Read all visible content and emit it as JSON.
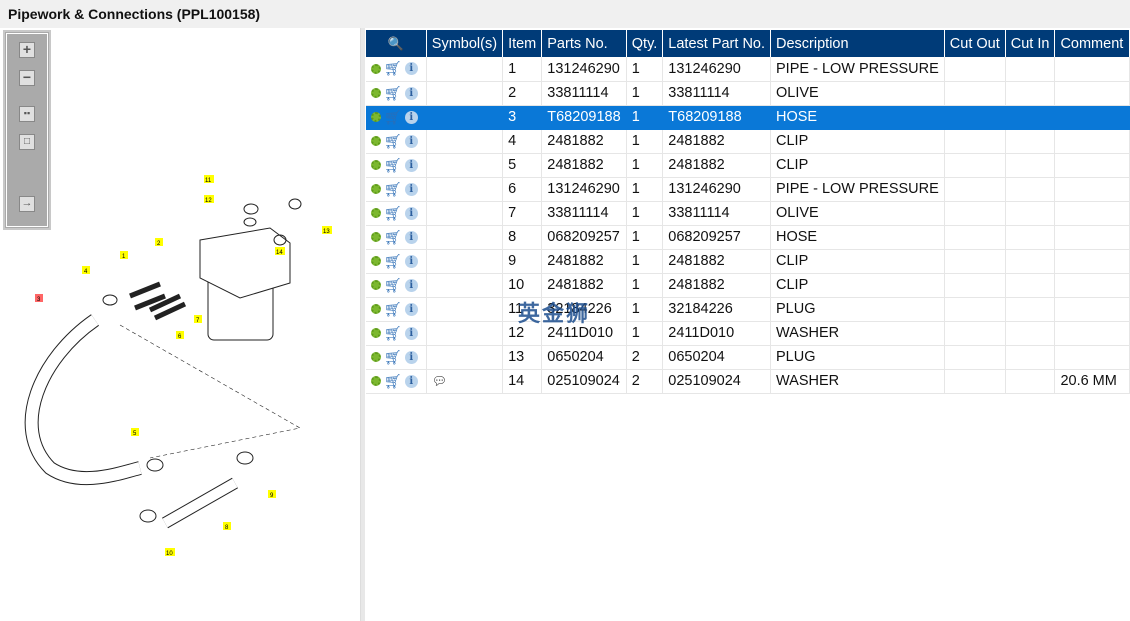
{
  "title": "Pipework & Connections (PPL100158)",
  "toolbar": [
    "zoom-in",
    "zoom-out",
    "fit-all",
    "fit-window",
    "toggle-panel"
  ],
  "diagram_labels": [
    "1",
    "2",
    "3",
    "4",
    "5",
    "6",
    "7",
    "8",
    "9",
    "10",
    "11",
    "12",
    "13",
    "14"
  ],
  "watermark": "英金狮",
  "columns": [
    "",
    "Symbol(s)",
    "Item",
    "Parts No.",
    "Qty.",
    "Latest Part No.",
    "Description",
    "Cut Out",
    "Cut In",
    "Comment"
  ],
  "rows": [
    {
      "symbol": "",
      "item": "1",
      "part": "131246290",
      "qty": "1",
      "latest": "131246290",
      "desc": "PIPE - LOW PRESSURE",
      "cutout": "",
      "cutin": "",
      "comment": ""
    },
    {
      "symbol": "",
      "item": "2",
      "part": "33811114",
      "qty": "1",
      "latest": "33811114",
      "desc": "OLIVE",
      "cutout": "",
      "cutin": "",
      "comment": ""
    },
    {
      "symbol": "",
      "item": "3",
      "part": "T68209188",
      "qty": "1",
      "latest": "T68209188",
      "desc": "HOSE",
      "cutout": "",
      "cutin": "",
      "comment": "",
      "selected": true
    },
    {
      "symbol": "",
      "item": "4",
      "part": "2481882",
      "qty": "1",
      "latest": "2481882",
      "desc": "CLIP",
      "cutout": "",
      "cutin": "",
      "comment": ""
    },
    {
      "symbol": "",
      "item": "5",
      "part": "2481882",
      "qty": "1",
      "latest": "2481882",
      "desc": "CLIP",
      "cutout": "",
      "cutin": "",
      "comment": ""
    },
    {
      "symbol": "",
      "item": "6",
      "part": "131246290",
      "qty": "1",
      "latest": "131246290",
      "desc": "PIPE - LOW PRESSURE",
      "cutout": "",
      "cutin": "",
      "comment": ""
    },
    {
      "symbol": "",
      "item": "7",
      "part": "33811114",
      "qty": "1",
      "latest": "33811114",
      "desc": "OLIVE",
      "cutout": "",
      "cutin": "",
      "comment": ""
    },
    {
      "symbol": "",
      "item": "8",
      "part": "068209257",
      "qty": "1",
      "latest": "068209257",
      "desc": "HOSE",
      "cutout": "",
      "cutin": "",
      "comment": ""
    },
    {
      "symbol": "",
      "item": "9",
      "part": "2481882",
      "qty": "1",
      "latest": "2481882",
      "desc": "CLIP",
      "cutout": "",
      "cutin": "",
      "comment": ""
    },
    {
      "symbol": "",
      "item": "10",
      "part": "2481882",
      "qty": "1",
      "latest": "2481882",
      "desc": "CLIP",
      "cutout": "",
      "cutin": "",
      "comment": ""
    },
    {
      "symbol": "",
      "item": "11",
      "part": "32184226",
      "qty": "1",
      "latest": "32184226",
      "desc": "PLUG",
      "cutout": "",
      "cutin": "",
      "comment": ""
    },
    {
      "symbol": "",
      "item": "12",
      "part": "2411D010",
      "qty": "1",
      "latest": "2411D010",
      "desc": "WASHER",
      "cutout": "",
      "cutin": "",
      "comment": ""
    },
    {
      "symbol": "",
      "item": "13",
      "part": "0650204",
      "qty": "2",
      "latest": "0650204",
      "desc": "PLUG",
      "cutout": "",
      "cutin": "",
      "comment": ""
    },
    {
      "symbol": "!",
      "item": "14",
      "part": "025109024",
      "qty": "2",
      "latest": "025109024",
      "desc": "WASHER",
      "cutout": "",
      "cutin": "",
      "comment": "20.6 MM"
    }
  ]
}
